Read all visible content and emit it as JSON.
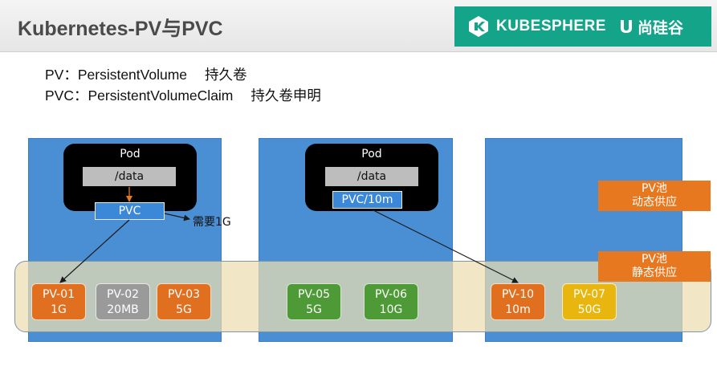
{
  "header": {
    "title": "Kubernetes-PV与PVC",
    "brand_kubesphere": "KUBESPHERE",
    "brand_sgg": "尚硅谷"
  },
  "definitions": [
    {
      "abbr": "PV：PersistentVolume",
      "cn": "持久卷"
    },
    {
      "abbr": "PVC：PersistentVolumeClaim",
      "cn": "持久卷申明"
    }
  ],
  "diagram": {
    "pods": [
      {
        "label": "Pod",
        "volume": "/data",
        "pvc": "PVC"
      },
      {
        "label": "Pod",
        "volume": "/data",
        "pvc": "PVC/10m"
      }
    ],
    "need_label": "需要1G",
    "pools": [
      {
        "line1": "PV池",
        "line2": "动态供应"
      },
      {
        "line1": "PV池",
        "line2": "静态供应"
      }
    ],
    "pvs": [
      {
        "name": "PV-01",
        "size": "1G",
        "color": "#e0701f"
      },
      {
        "name": "PV-02",
        "size": "20MB",
        "color": "#9a9a9a"
      },
      {
        "name": "PV-03",
        "size": "5G",
        "color": "#e0701f"
      },
      {
        "name": "PV-05",
        "size": "5G",
        "color": "#4e9a36"
      },
      {
        "name": "PV-06",
        "size": "10G",
        "color": "#4e9a36"
      },
      {
        "name": "PV-10",
        "size": "10m",
        "color": "#e0701f"
      },
      {
        "name": "PV-07",
        "size": "50G",
        "color": "#e8b60e"
      }
    ]
  },
  "colors": {
    "brand": "#14a48a",
    "column": "#4a8fd4",
    "pool": "#e8781f",
    "band": "#ebdeb2"
  }
}
